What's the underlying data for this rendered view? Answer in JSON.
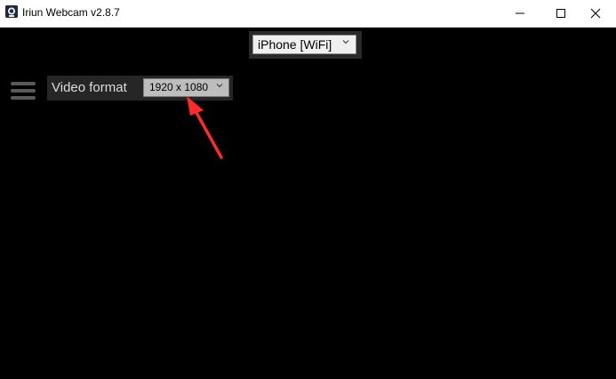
{
  "window": {
    "title": "Iriun Webcam v2.8.7"
  },
  "device_selector": {
    "value": "iPhone [WiFi]"
  },
  "video_format": {
    "label": "Video format",
    "value": "1920 x 1080"
  },
  "colors": {
    "background": "#000000",
    "titlebar": "#ffffff",
    "annotation_arrow": "#ff2a2a"
  },
  "icons": {
    "app": "iriun-camera-icon",
    "menu": "hamburger-menu-icon",
    "minimize": "minimize-icon",
    "maximize": "maximize-icon",
    "close": "close-icon",
    "dropdown": "chevron-down-icon"
  }
}
